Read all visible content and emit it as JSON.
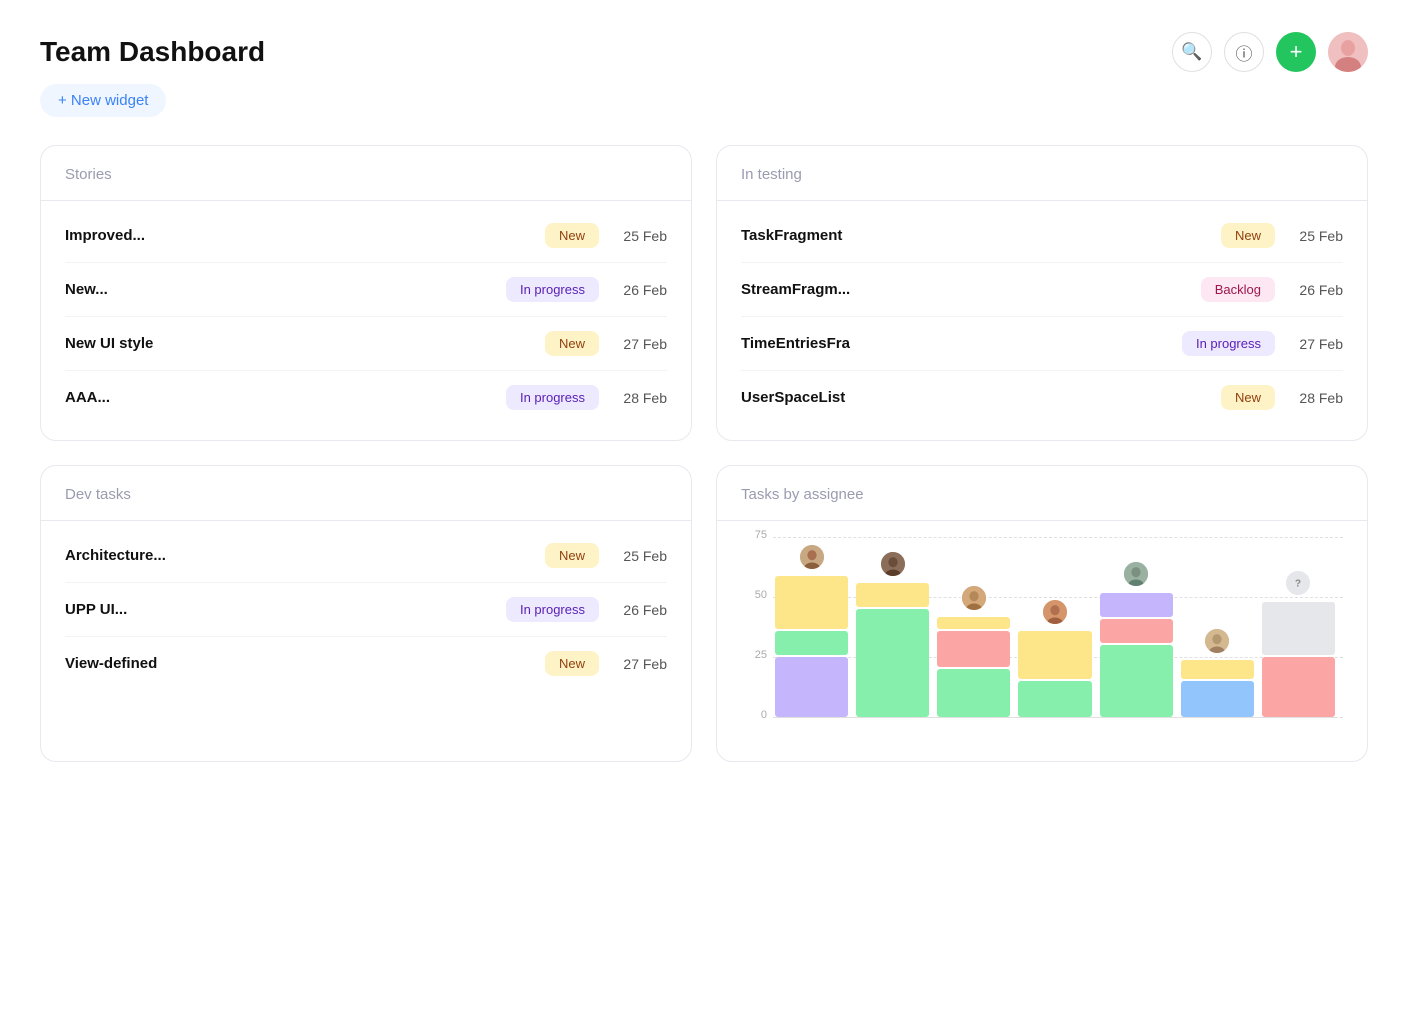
{
  "header": {
    "title": "Team Dashboard",
    "new_widget_label": "+ New widget",
    "search_tooltip": "Search",
    "help_tooltip": "Help",
    "add_tooltip": "Add",
    "avatar_alt": "User avatar"
  },
  "widgets": {
    "stories": {
      "title": "Stories",
      "rows": [
        {
          "name": "Improved...",
          "status": "New",
          "status_type": "new",
          "date": "25 Feb"
        },
        {
          "name": "New...",
          "status": "In progress",
          "status_type": "inprogress",
          "date": "26 Feb"
        },
        {
          "name": "New UI style",
          "status": "New",
          "status_type": "new",
          "date": "27 Feb"
        },
        {
          "name": "AAA...",
          "status": "In progress",
          "status_type": "inprogress",
          "date": "28 Feb"
        }
      ]
    },
    "in_testing": {
      "title": "In testing",
      "rows": [
        {
          "name": "TaskFragment",
          "status": "New",
          "status_type": "new",
          "date": "25 Feb"
        },
        {
          "name": "StreamFragm...",
          "status": "Backlog",
          "status_type": "backlog",
          "date": "26 Feb"
        },
        {
          "name": "TimeEntriesFra",
          "status": "In progress",
          "status_type": "inprogress",
          "date": "27 Feb"
        },
        {
          "name": "UserSpaceList",
          "status": "New",
          "status_type": "new",
          "date": "28 Feb"
        }
      ]
    },
    "dev_tasks": {
      "title": "Dev tasks",
      "rows": [
        {
          "name": "Architecture...",
          "status": "New",
          "status_type": "new",
          "date": "25 Feb"
        },
        {
          "name": "UPP UI...",
          "status": "In progress",
          "status_type": "inprogress",
          "date": "26 Feb"
        },
        {
          "name": "View-defined",
          "status": "New",
          "status_type": "new",
          "date": "27 Feb"
        }
      ]
    },
    "tasks_by_assignee": {
      "title": "Tasks by assignee",
      "y_labels": [
        "75",
        "50",
        "25",
        "0"
      ],
      "bars": [
        {
          "avatar_label": "P1",
          "avatar_color": "#c8a882",
          "segments": [
            {
              "color": "#c4b5fd",
              "height_pct": 25
            },
            {
              "color": "#86efac",
              "height_pct": 10
            },
            {
              "color": "#fde68a",
              "height_pct": 22
            }
          ]
        },
        {
          "avatar_label": "P2",
          "avatar_color": "#8b6e5a",
          "segments": [
            {
              "color": "#86efac",
              "height_pct": 45
            },
            {
              "color": "#fde68a",
              "height_pct": 10
            }
          ]
        },
        {
          "avatar_label": "P3",
          "avatar_color": "#b89075",
          "segments": [
            {
              "color": "#86efac",
              "height_pct": 20
            },
            {
              "color": "#fca5a5",
              "height_pct": 15
            },
            {
              "color": "#fde68a",
              "height_pct": 5
            }
          ]
        },
        {
          "avatar_label": "P4",
          "avatar_color": "#d4956a",
          "segments": [
            {
              "color": "#86efac",
              "height_pct": 15
            },
            {
              "color": "#fde68a",
              "height_pct": 20
            }
          ]
        },
        {
          "avatar_label": "P5",
          "avatar_color": "#7a9e8a",
          "segments": [
            {
              "color": "#86efac",
              "height_pct": 30
            },
            {
              "color": "#fca5a5",
              "height_pct": 10
            },
            {
              "color": "#c4b5fd",
              "height_pct": 10
            }
          ]
        },
        {
          "avatar_label": "P6",
          "avatar_color": "#c9a97c",
          "segments": [
            {
              "color": "#93c5fd",
              "height_pct": 15
            },
            {
              "color": "#fde68a",
              "height_pct": 8
            }
          ]
        },
        {
          "avatar_label": "?",
          "avatar_color": "#e5e7eb",
          "segments": [
            {
              "color": "#fca5a5",
              "height_pct": 25
            },
            {
              "color": "#e5e7eb",
              "height_pct": 22
            }
          ]
        }
      ]
    }
  }
}
